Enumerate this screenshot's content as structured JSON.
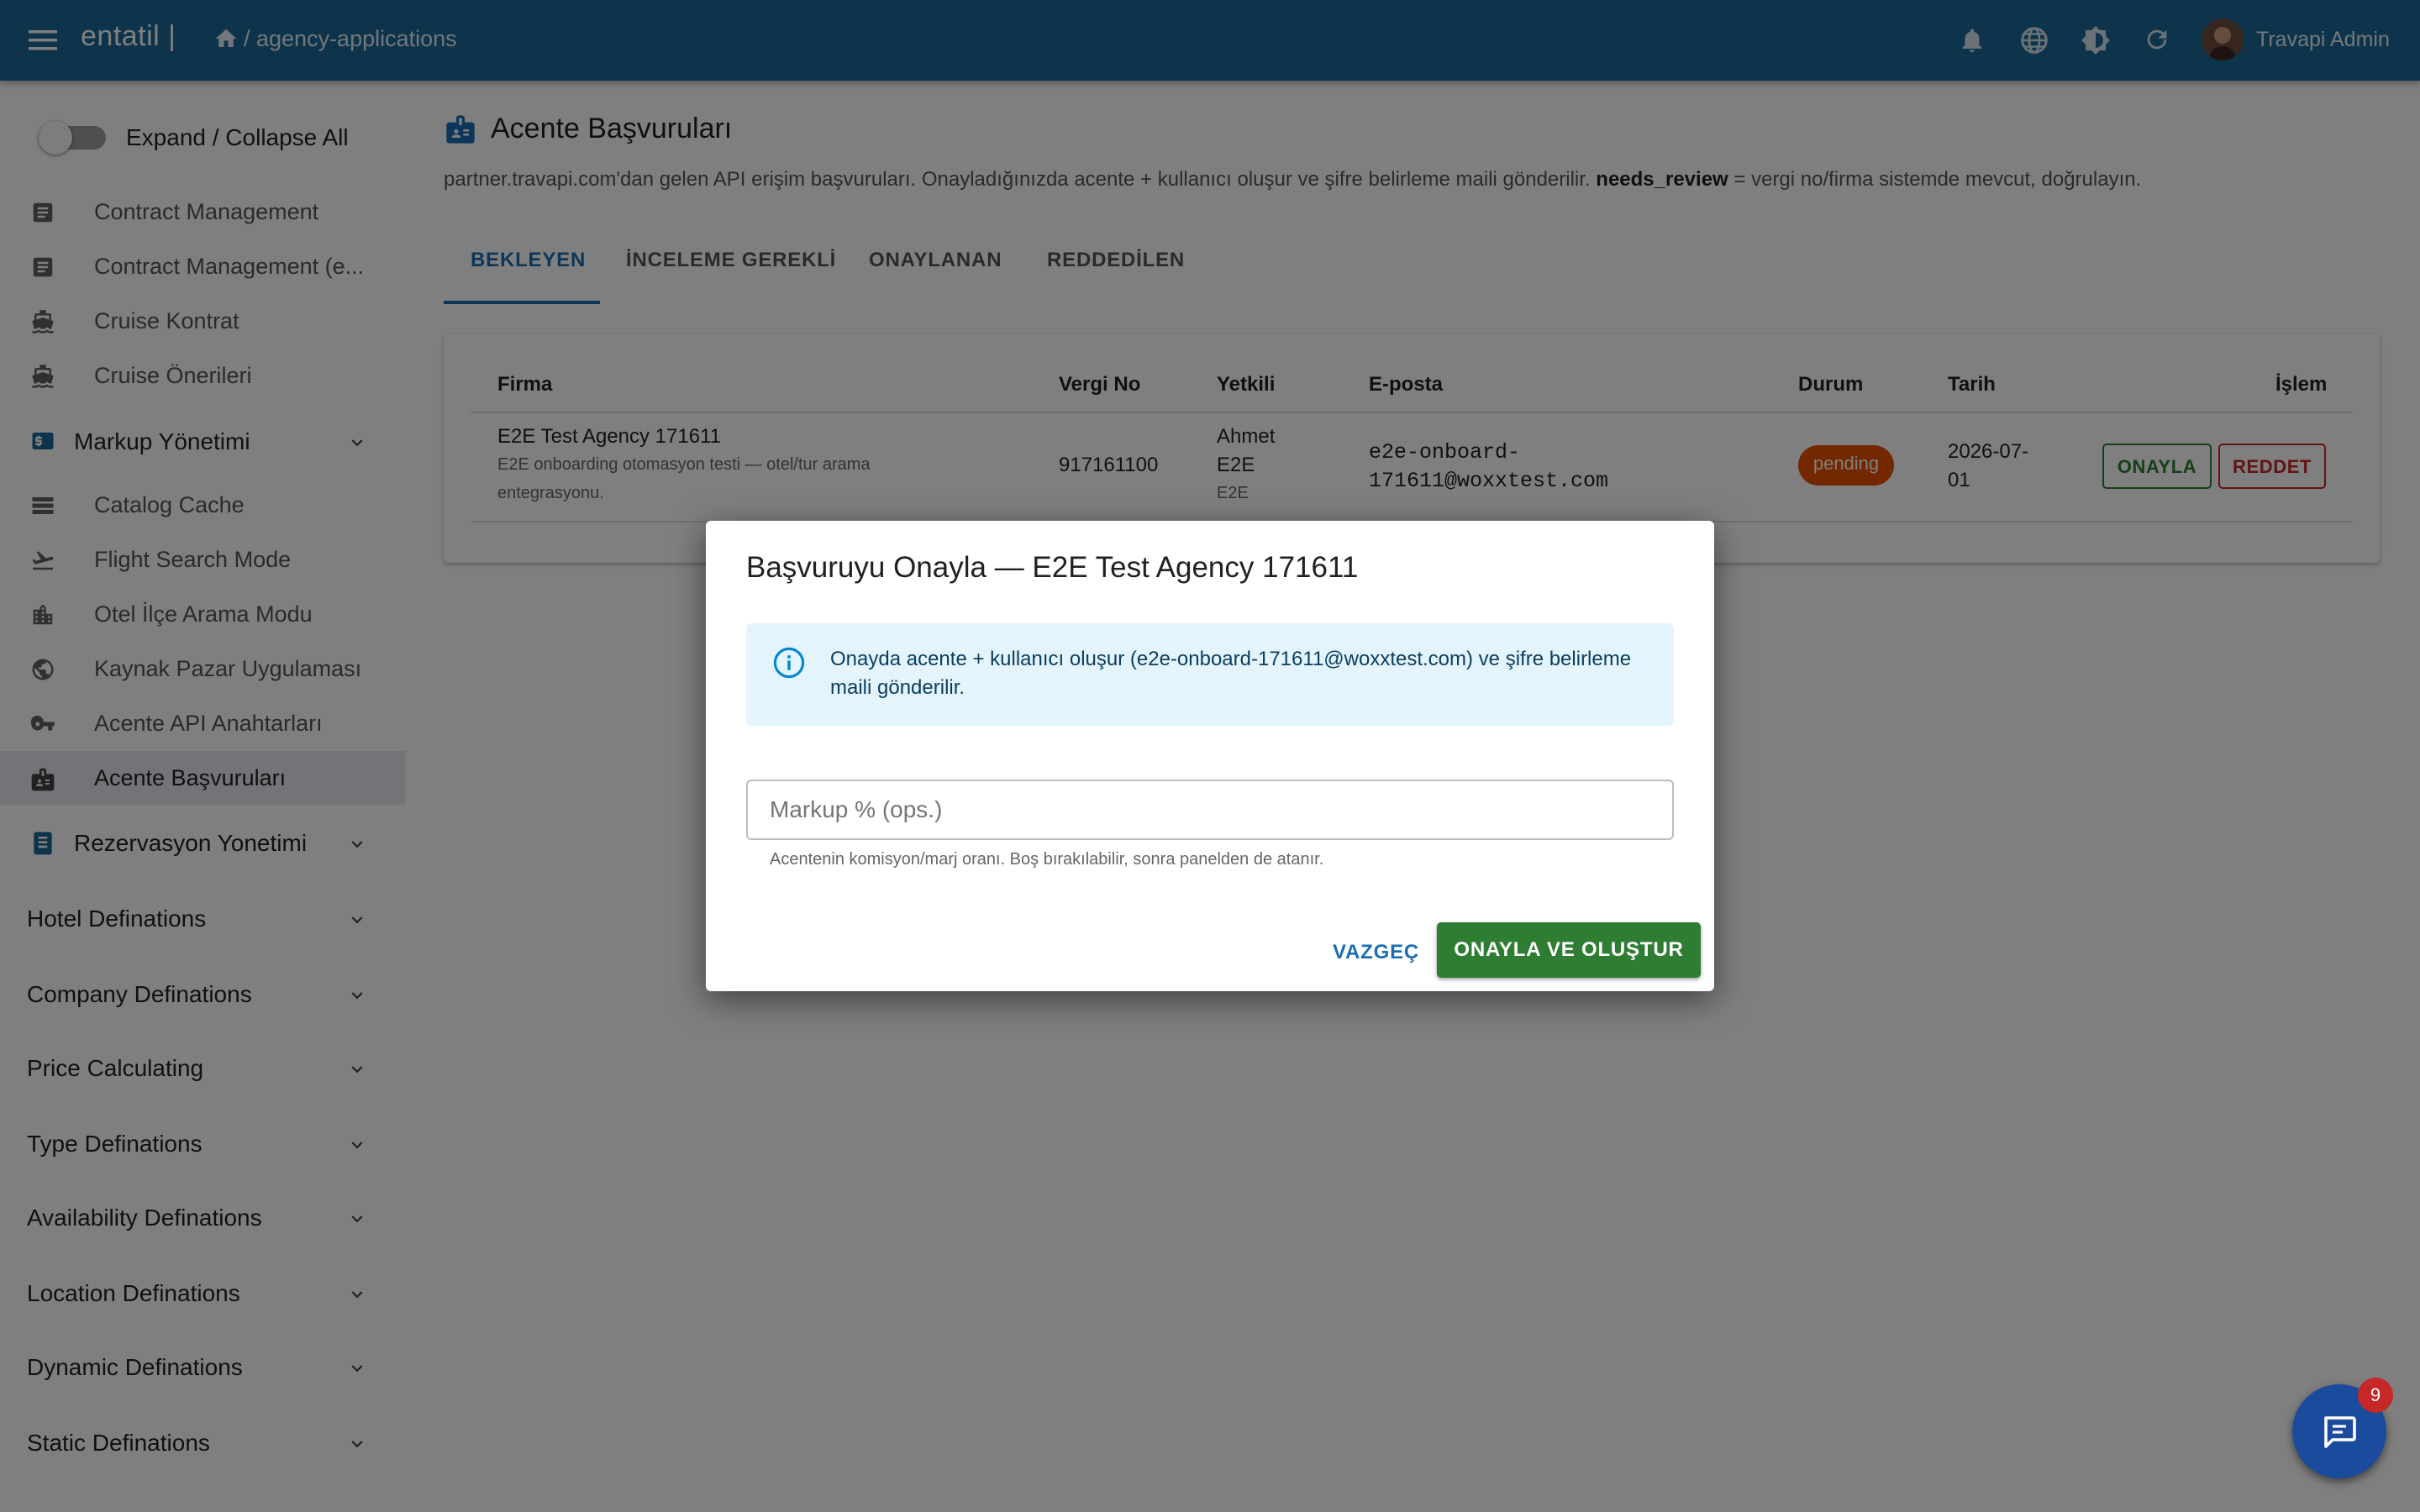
{
  "topbar": {
    "brand": "entatil |",
    "path": "/ agency-applications",
    "user": "Travapi Admin",
    "icons": [
      "menu-icon",
      "home-icon",
      "bell-icon",
      "globe-icon",
      "brightness-icon",
      "refresh-icon"
    ]
  },
  "sidebar": {
    "expand_label": "Expand / Collapse All",
    "items": [
      {
        "label": "Contract Management",
        "icon": "document-icon"
      },
      {
        "label": "Contract Management (e...",
        "icon": "document-icon"
      },
      {
        "label": "Cruise Kontrat",
        "icon": "ship-icon"
      },
      {
        "label": "Cruise Önerileri",
        "icon": "ship-icon"
      },
      {
        "label": "Catalog Cache",
        "icon": "list-icon"
      },
      {
        "label": "Flight Search Mode",
        "icon": "flight-icon"
      },
      {
        "label": "Otel İlçe Arama Modu",
        "icon": "building-icon"
      },
      {
        "label": "Kaynak Pazar Uygulaması",
        "icon": "globe-icon"
      },
      {
        "label": "Acente API Anahtarları",
        "icon": "key-icon"
      },
      {
        "label": "Acente Başvuruları",
        "icon": "badge-icon"
      }
    ],
    "groups": [
      {
        "label": "Markup Yönetimi",
        "icon": "price-icon"
      },
      {
        "label": "Rezervasyon Yonetimi",
        "icon": "book-icon"
      },
      {
        "label": "Hotel Definations"
      },
      {
        "label": "Company Definations"
      },
      {
        "label": "Price Calculating"
      },
      {
        "label": "Type Definations"
      },
      {
        "label": "Availability Definations"
      },
      {
        "label": "Location Definations"
      },
      {
        "label": "Dynamic Definations"
      },
      {
        "label": "Static Definations"
      }
    ]
  },
  "main": {
    "title": "Acente Başvuruları",
    "description_pre": "partner.travapi.com'dan gelen API erişim başvuruları. Onayladığınızda acente + kullanıcı oluşur ve şifre belirleme maili gönderilir. ",
    "description_bold": "needs_review",
    "description_post": " = vergi no/firma sistemde mevcut, doğrulayın.",
    "tabs": [
      "BEKLEYEN",
      "İNCELEME GEREKLİ",
      "ONAYLANAN",
      "REDDEDİLEN"
    ],
    "active_tab": 0,
    "table": {
      "columns": [
        "Firma",
        "Vergi No",
        "Yetkili",
        "E-posta",
        "Durum",
        "Tarih",
        "İşlem"
      ],
      "rows": [
        {
          "firma": "E2E Test Agency 171611",
          "firma_desc_1": "E2E onboarding otomasyon testi — otel/tur arama",
          "firma_desc_2": "entegrasyonu.",
          "vergi_no": "917161100",
          "yetkili_1": "Ahmet",
          "yetkili_2": "E2E",
          "yetkili_sub": "E2E",
          "email_1": "e2e-onboard-",
          "email_2": "171611@woxxtest.com",
          "durum": "pending",
          "tarih_1": "2026-07-",
          "tarih_2": "01",
          "approve": "ONAYLA",
          "reject": "REDDET"
        }
      ]
    }
  },
  "dialog": {
    "title": "Başvuruyu Onayla — E2E Test Agency 171611",
    "info": "Onayda acente + kullanıcı oluşur (e2e-onboard-171611@woxxtest.com) ve şifre belirleme maili gönderilir.",
    "field_placeholder": "Markup % (ops.)",
    "helper": "Acentenin komisyon/marj oranı. Boş bırakılabilir, sonra panelden de atanır.",
    "cancel": "VAZGEÇ",
    "confirm": "ONAYLA VE OLUŞTUR"
  },
  "chat": {
    "badge": "9"
  },
  "colors": {
    "topbar": "#1b6896",
    "accent": "#1b6eb4",
    "success": "#2e7d32",
    "danger": "#c62828",
    "pending": "#e65100"
  }
}
